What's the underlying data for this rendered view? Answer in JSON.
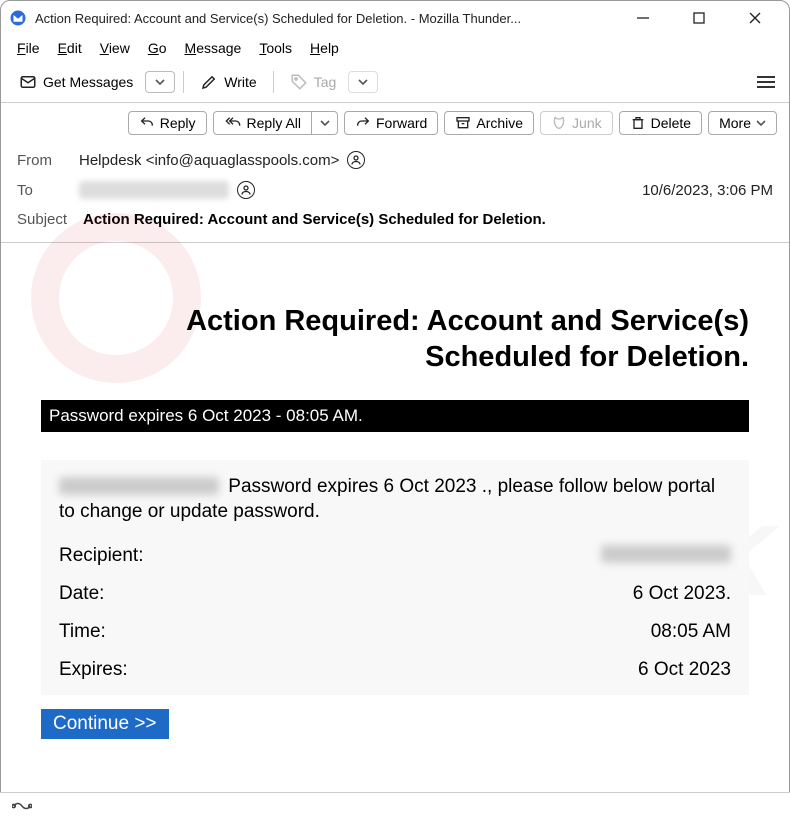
{
  "window": {
    "title": "Action Required: Account and Service(s) Scheduled for Deletion. - Mozilla Thunder..."
  },
  "menubar": {
    "file": "File",
    "edit": "Edit",
    "view": "View",
    "go": "Go",
    "message": "Message",
    "tools": "Tools",
    "help": "Help"
  },
  "toolbar": {
    "get_messages": "Get Messages",
    "write": "Write",
    "tag": "Tag"
  },
  "actions": {
    "reply": "Reply",
    "reply_all": "Reply All",
    "forward": "Forward",
    "archive": "Archive",
    "junk": "Junk",
    "delete": "Delete",
    "more": "More"
  },
  "header": {
    "from_label": "From",
    "from_value": "Helpdesk <info@aquaglasspools.com>",
    "to_label": "To",
    "date": "10/6/2023, 3:06 PM",
    "subject_label": "Subject",
    "subject_value": "Action Required: Account and Service(s) Scheduled for Deletion."
  },
  "email": {
    "heading": "Action Required: Account and Service(s) Scheduled for Deletion.",
    "banner": "Password expires  6 Oct 2023 - 08:05 AM.",
    "body_text": " Password expires 6 Oct 2023 ., please follow below portal to change or update password.",
    "recipient_label": "Recipient:",
    "date_label": "Date:",
    "date_value": "6 Oct 2023.",
    "time_label": "Time:",
    "time_value": "08:05 AM",
    "expires_label": "Expires:",
    "expires_value": "6 Oct 2023",
    "continue": "Continue >>"
  }
}
